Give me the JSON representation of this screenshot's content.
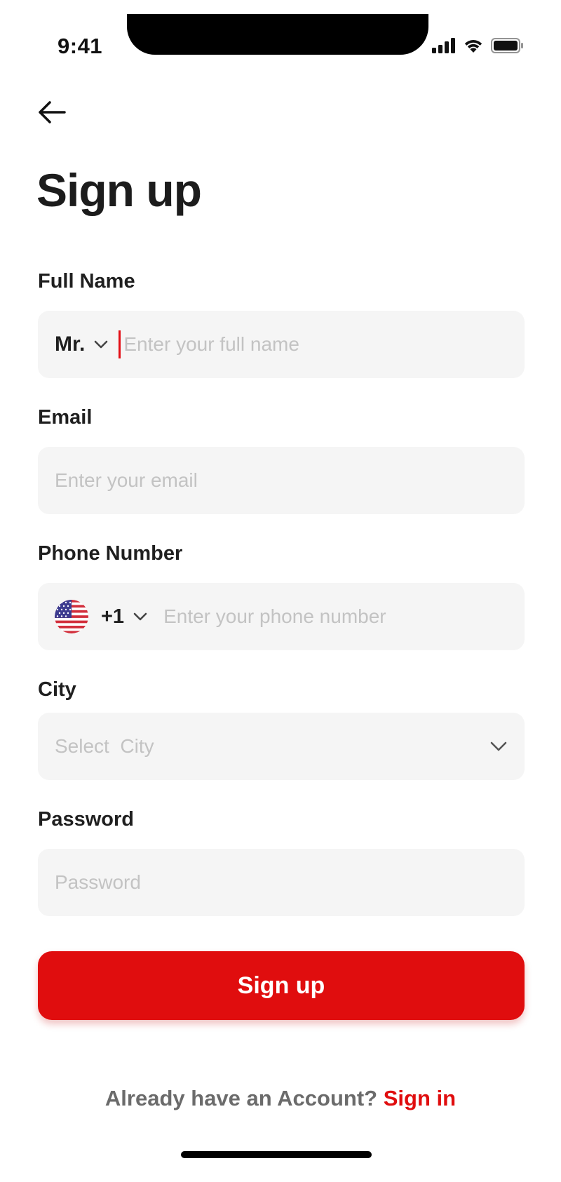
{
  "status_bar": {
    "time": "9:41"
  },
  "page": {
    "title": "Sign up"
  },
  "fields": {
    "full_name": {
      "label": "Full Name",
      "title_value": "Mr.",
      "placeholder": "Enter your full name"
    },
    "email": {
      "label": "Email",
      "placeholder": "Enter your email"
    },
    "phone": {
      "label": "Phone Number",
      "dial_code": "+1",
      "placeholder": "Enter your phone number"
    },
    "city": {
      "label": "City",
      "placeholder": "Select  City"
    },
    "password": {
      "label": "Password",
      "placeholder": "Password"
    }
  },
  "submit": {
    "label": "Sign up"
  },
  "footer": {
    "prompt": "Already have an Account?",
    "link": "Sign in"
  },
  "colors": {
    "accent": "#e00d0e",
    "field_bg": "#f5f5f5",
    "placeholder": "#c3c3c3"
  },
  "icons": {
    "back": "arrow-left-icon",
    "chevron": "chevron-down-icon",
    "flag": "us-flag-icon"
  }
}
